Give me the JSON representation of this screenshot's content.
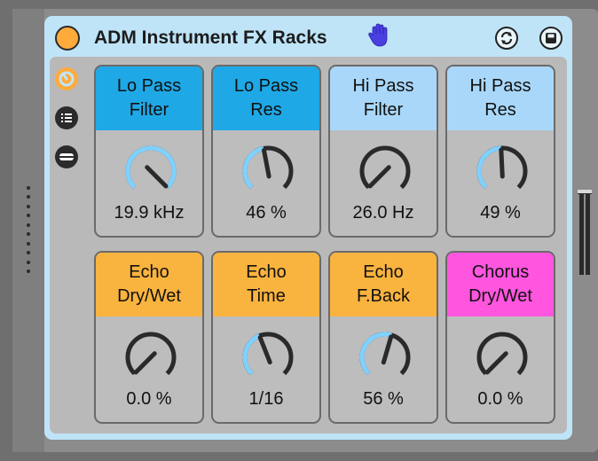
{
  "device": {
    "title": "ADM Instrument FX Racks",
    "header_active_color": "#ffab3c",
    "header_background": "#bfe4f8",
    "hotswap_icon": "hand-icon",
    "header_buttons": [
      {
        "name": "refresh-icon"
      },
      {
        "name": "save-icon"
      }
    ],
    "side_icons": [
      {
        "name": "macro-knob-icon",
        "active": true
      },
      {
        "name": "list-icon",
        "active": false
      },
      {
        "name": "minimize-icon",
        "active": false
      }
    ]
  },
  "knobs": [
    {
      "line1": "Lo Pass",
      "line2": "Filter",
      "value": "19.9 kHz",
      "level": 1.0,
      "color": "#1fa8e6"
    },
    {
      "line1": "Lo Pass",
      "line2": "Res",
      "value": "46 %",
      "level": 0.46,
      "color": "#1fa8e6"
    },
    {
      "line1": "Hi Pass",
      "line2": "Filter",
      "value": "26.0 Hz",
      "level": 0.0,
      "color": "#a9d7f9"
    },
    {
      "line1": "Hi Pass",
      "line2": "Res",
      "value": "49 %",
      "level": 0.49,
      "color": "#a9d7f9"
    },
    {
      "line1": "Echo",
      "line2": "Dry/Wet",
      "value": "0.0 %",
      "level": 0.0,
      "color": "#f9b33f"
    },
    {
      "line1": "Echo",
      "line2": "Time",
      "value": "1/16",
      "level": 0.42,
      "color": "#f9b33f"
    },
    {
      "line1": "Echo",
      "line2": "F.Back",
      "value": "56 %",
      "level": 0.56,
      "color": "#f9b33f"
    },
    {
      "line1": "Chorus",
      "line2": "Dry/Wet",
      "value": "0.0 %",
      "level": 0.0,
      "color": "#ff55df"
    }
  ],
  "knob_arc_color": "#7fd1ff",
  "knob_ring_color": "#2a2a2a"
}
